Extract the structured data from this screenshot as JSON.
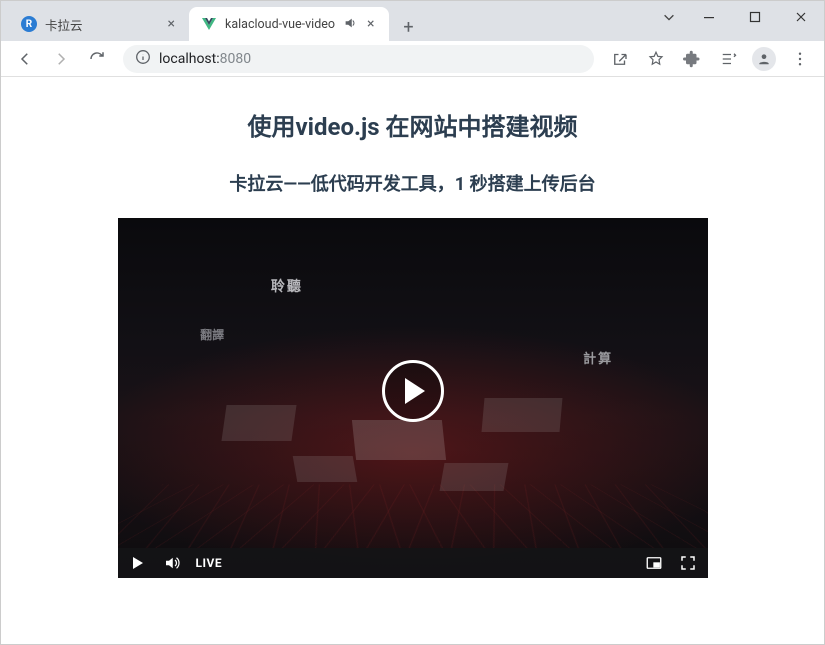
{
  "window": {
    "tabs": [
      {
        "title": "卡拉云",
        "favicon": "R"
      },
      {
        "title": "kalacloud-vue-video",
        "favicon": "V",
        "audio": true
      }
    ],
    "address": {
      "host": "localhost:",
      "port": "8080"
    }
  },
  "page": {
    "heading": "使用video.js 在网站中搭建视频",
    "subheading": "卡拉云——低代码开发工具，1 秒搭建上传后台",
    "video": {
      "live_label": "LIVE",
      "kw1": "聆聽",
      "kw2": "翻譯",
      "kw3": "計算"
    }
  }
}
